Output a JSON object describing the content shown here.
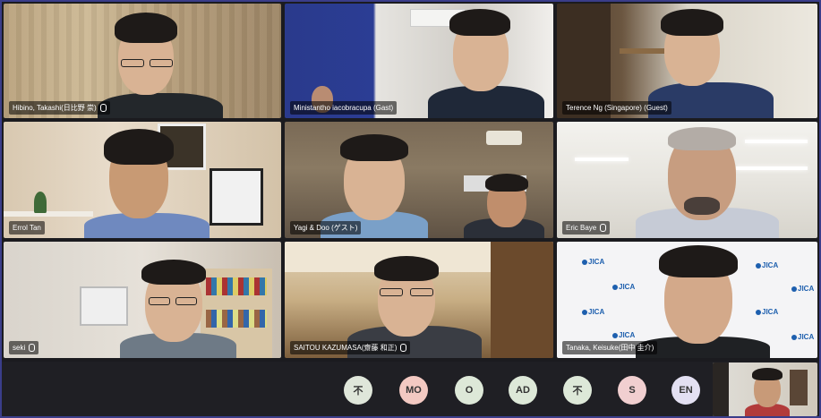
{
  "participants": [
    {
      "name": "Hibino, Takashi(日比野 崇)"
    },
    {
      "name": "Ministantho iacobracupa (Gast)"
    },
    {
      "name": "Terence Ng (Singapore) (Guest)"
    },
    {
      "name": "Errol Tan"
    },
    {
      "name": "Yagi & Doo (ゲスト)"
    },
    {
      "name": "Eric Baye"
    },
    {
      "name": "seki"
    },
    {
      "name": "SAITOU KAZUMASA(齋藤 和正)"
    },
    {
      "name": "Tanaka, Keisuke(田中 圭介)"
    }
  ],
  "avatars": [
    {
      "label": "不",
      "bg": "#dfe6da",
      "fg": "#333333"
    },
    {
      "label": "MO",
      "bg": "#f3c9c2",
      "fg": "#333333"
    },
    {
      "label": "O",
      "bg": "#dde8d8",
      "fg": "#333333"
    },
    {
      "label": "AD",
      "bg": "#dde8d8",
      "fg": "#333333"
    },
    {
      "label": "不",
      "bg": "#dde8d8",
      "fg": "#333333"
    },
    {
      "label": "S",
      "bg": "#f1cfd0",
      "fg": "#333333"
    },
    {
      "label": "EN",
      "bg": "#e3e0f2",
      "fg": "#333333"
    }
  ],
  "logo_text": "JICA",
  "colors": {
    "frame": "#3a3d8a",
    "bar": "#1f1f24",
    "brand": "#1d5fae"
  }
}
